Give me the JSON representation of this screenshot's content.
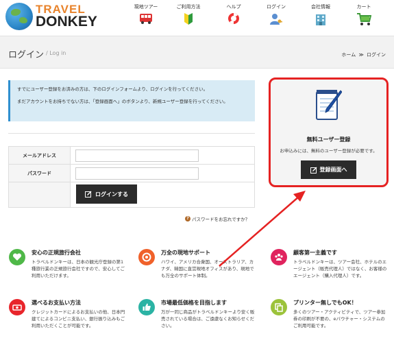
{
  "logo": {
    "line1": "TRAVEL",
    "line2": "DONKEY"
  },
  "nav": [
    {
      "label": "現地ツアー",
      "icon": "bus-icon"
    },
    {
      "label": "ご利用方法",
      "icon": "beginner-mark-icon"
    },
    {
      "label": "ヘルプ",
      "icon": "lifebuoy-icon"
    },
    {
      "label": "ログイン",
      "icon": "user-key-icon"
    },
    {
      "label": "会社情報",
      "icon": "building-icon"
    },
    {
      "label": "カート",
      "icon": "cart-icon"
    }
  ],
  "page": {
    "title": "ログイン",
    "subtitle": "/ Log in"
  },
  "breadcrumb": {
    "home": "ホーム",
    "sep": "≫",
    "current": "ログイン"
  },
  "info": {
    "line1": "すでにユーザー登録をお済みの方は、下のログインフォームより、ログインを行ってください。",
    "line2": "まだアカウントをお持ちでない方は、「登録画面へ」のボタンより、新規ユーザー登録を行ってください。"
  },
  "form": {
    "email_label": "メールアドレス",
    "email_value": "",
    "password_label": "パスワード",
    "password_value": "",
    "login_button": "ログインする",
    "forgot": "パスワードをお忘れですか？"
  },
  "register": {
    "title": "無料ユーザー登録",
    "desc": "お申込みには、無料のユーザー登録が必要です。",
    "button": "登録画面へ"
  },
  "features": [
    {
      "title": "安心の正規旅行会社",
      "desc": "トラベルドンキーは、日本の観光庁登録の第1種旅行業の正規旅行会社ですので、安心してご利用いただけます。",
      "icon": "heart-icon",
      "color": "#4fb848"
    },
    {
      "title": "万全の現地サポート",
      "desc": "ハワイ、アメリカ合衆国、オーストラリア、カナダ、韓国に直営現地オフィスがあり、現地でも万全のサポート体制。",
      "icon": "lifebuoy-icon",
      "color": "#f0612a"
    },
    {
      "title": "顧客第一主義です",
      "desc": "トラベルドンキーは、ツアー会社、ホテルのエージェント（販売代理人）ではなく、お客様のエージェント（購入代理人）です。",
      "icon": "people-icon",
      "color": "#e0245e"
    },
    {
      "title": "選べるお支払い方法",
      "desc": "クレジットカードによるお支払いの他、日本円建てによるコンビニ支払い、銀行振り込みもご利用いただくことが可能です。",
      "icon": "money-icon",
      "color": "#e8252b"
    },
    {
      "title": "市場最低価格を目指します",
      "desc": "万が一同じ商品がトラベルドンキーより安く販売されている場合は、ご遠慮なくお知らせください。",
      "icon": "thumbs-up-icon",
      "color": "#2bb3a4"
    },
    {
      "title": "プリンター無しでもOK！",
      "desc": "多くのツアー・アクティビティで、ツアー参加券の印刷が不要の、eバウチャー・システムのご利用可能です。",
      "icon": "copy-icon",
      "color": "#9cc33b"
    }
  ],
  "colors": {
    "accent_red": "#e52222",
    "button_dark": "#2b2b2b",
    "info_bg": "#d8ebf5"
  }
}
